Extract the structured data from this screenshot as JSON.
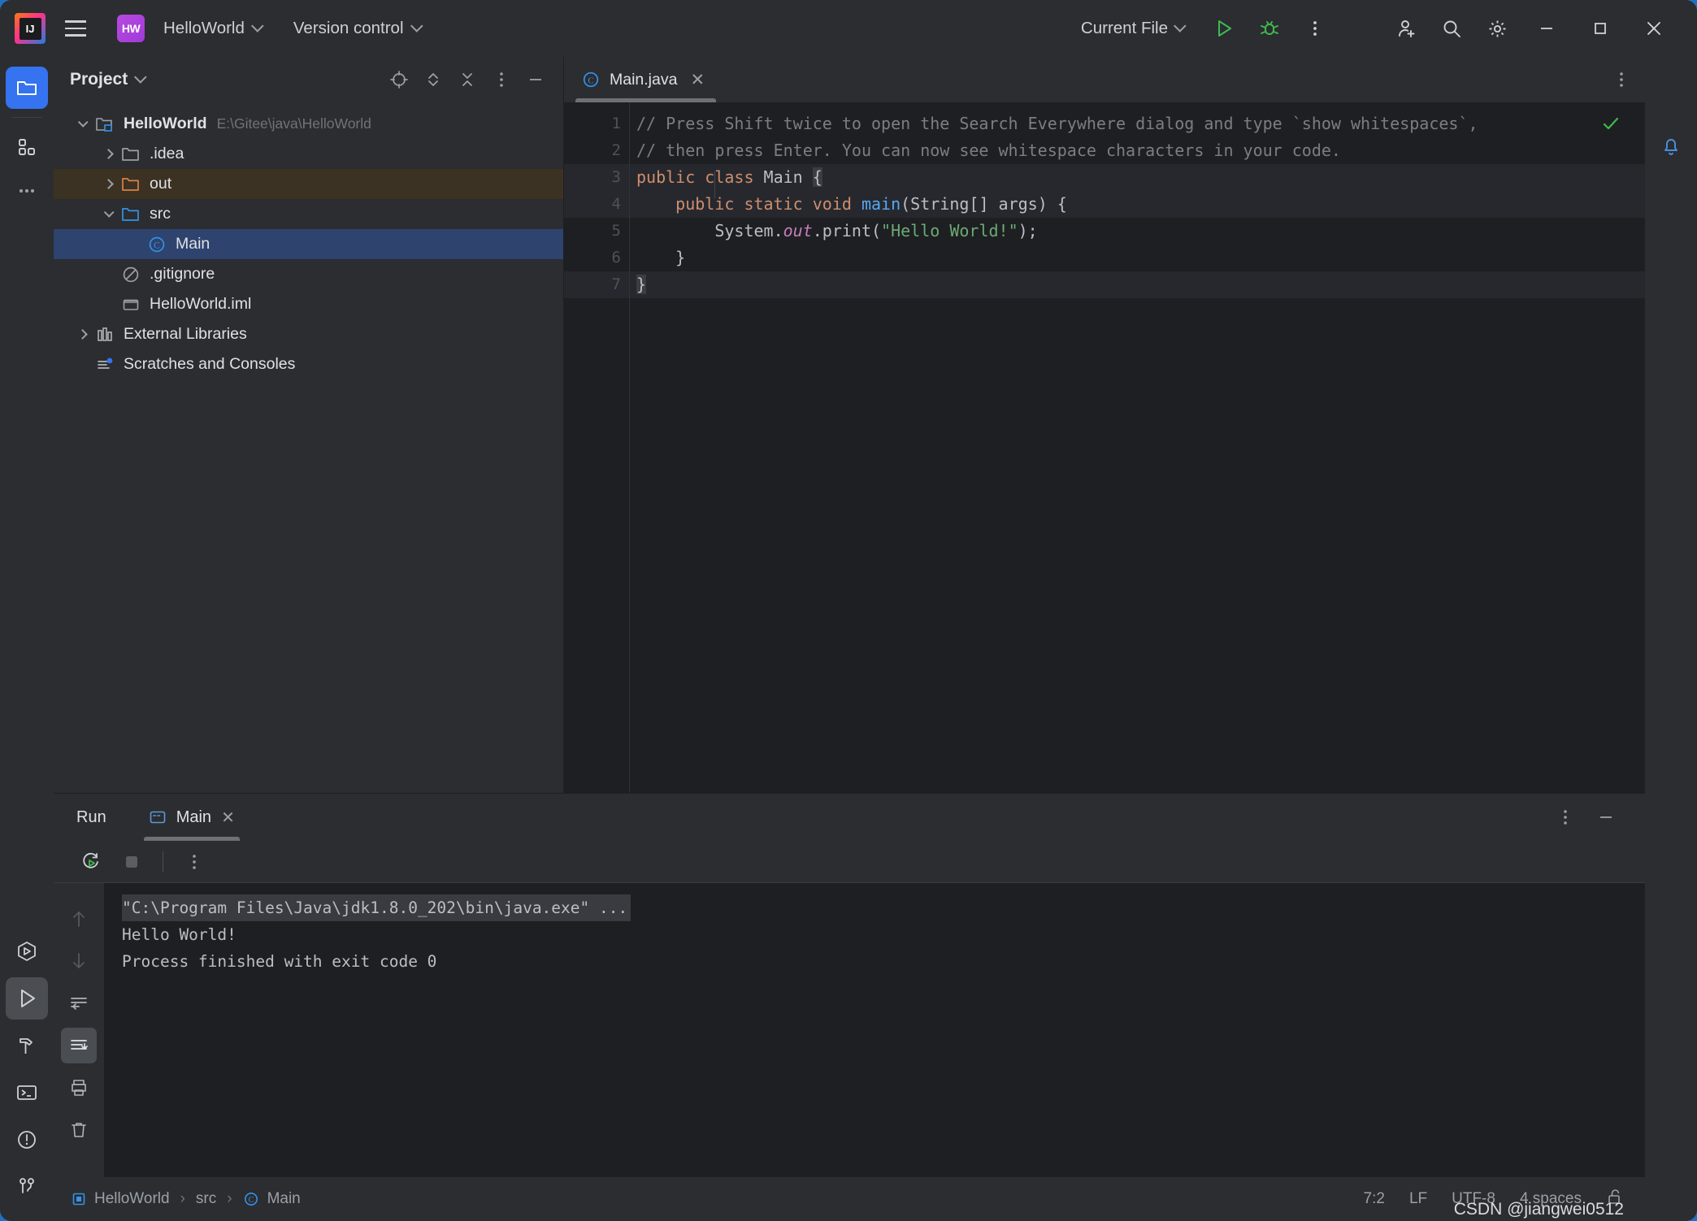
{
  "titlebar": {
    "logo_icon": "intellij-idea-logo",
    "menu_icon": "hamburger-menu-icon",
    "project_badge": "HW",
    "project_name": "HelloWorld",
    "version_control": "Version control",
    "run_config": "Current File",
    "run_icon": "run-icon",
    "debug_icon": "debug-icon",
    "more_icon": "more-vertical-icon",
    "account_icon": "add-user-icon",
    "search_icon": "search-icon",
    "settings_icon": "gear-icon",
    "minimize_icon": "minimize-icon",
    "maximize_icon": "maximize-icon",
    "close_icon": "close-icon"
  },
  "leftstrip": {
    "items": [
      {
        "name": "project-tool-window",
        "icon": "folder-icon",
        "active": true
      },
      {
        "name": "structure-tool-window",
        "icon": "structure-icon",
        "active": false
      },
      {
        "name": "more-tool-windows",
        "icon": "more-horizontal-icon",
        "active": false
      }
    ],
    "bottom_items": [
      {
        "name": "services-tool-window",
        "icon": "services-icon",
        "active": false
      },
      {
        "name": "run-tool-window",
        "icon": "run-triangle-icon",
        "active": true
      },
      {
        "name": "build-tool-window",
        "icon": "hammer-icon",
        "active": false
      },
      {
        "name": "terminal-tool-window",
        "icon": "terminal-icon",
        "active": false
      },
      {
        "name": "problems-tool-window",
        "icon": "warning-circle-icon",
        "active": false
      },
      {
        "name": "version-control-tool-window",
        "icon": "branch-icon",
        "active": false
      }
    ]
  },
  "project_panel": {
    "title": "Project",
    "chevron_icon": "chevron-down-icon",
    "tools": [
      {
        "name": "select-opened-file-button",
        "icon": "crosshair-icon"
      },
      {
        "name": "expand-collapse-button",
        "icon": "expand-collapse-icon"
      },
      {
        "name": "collapse-all-button",
        "icon": "collapse-all-icon"
      },
      {
        "name": "options-button",
        "icon": "more-vertical-icon"
      },
      {
        "name": "hide-button",
        "icon": "minimize-icon"
      }
    ],
    "tree": [
      {
        "label": "HelloWorld",
        "path": "E:\\Gitee\\java\\HelloWorld",
        "icon": "project-folder-icon",
        "depth": 0,
        "arrow": "open",
        "state": "normal",
        "bold": true
      },
      {
        "label": ".idea",
        "path": "",
        "icon": "folder-gray-icon",
        "depth": 1,
        "arrow": "closed",
        "state": "normal",
        "bold": false
      },
      {
        "label": "out",
        "path": "",
        "icon": "folder-orange-icon",
        "depth": 1,
        "arrow": "closed",
        "state": "highlight",
        "bold": false
      },
      {
        "label": "src",
        "path": "",
        "icon": "folder-blue-icon",
        "depth": 1,
        "arrow": "open",
        "state": "normal",
        "bold": false
      },
      {
        "label": "Main",
        "path": "",
        "icon": "java-class-icon",
        "depth": 2,
        "arrow": "none",
        "state": "selected",
        "bold": false
      },
      {
        "label": ".gitignore",
        "path": "",
        "icon": "gitignore-icon",
        "depth": 1,
        "arrow": "none",
        "state": "normal",
        "bold": false
      },
      {
        "label": "HelloWorld.iml",
        "path": "",
        "icon": "iml-file-icon",
        "depth": 1,
        "arrow": "none",
        "state": "normal",
        "bold": false
      },
      {
        "label": "External Libraries",
        "path": "",
        "icon": "library-icon",
        "depth": 0,
        "arrow": "closed",
        "state": "normal",
        "bold": false
      },
      {
        "label": "Scratches and Consoles",
        "path": "",
        "icon": "scratches-icon",
        "depth": 0,
        "arrow": "none",
        "state": "normal",
        "bold": false
      }
    ]
  },
  "editor": {
    "tab": {
      "label": "Main.java",
      "icon": "java-class-icon",
      "close_icon": "close-icon"
    },
    "more_icon": "more-vertical-icon",
    "inspection_icon": "checkmark-ok-icon",
    "line_numbers": [
      "1",
      "2",
      "3",
      "4",
      "5",
      "6",
      "7"
    ],
    "lines": [
      {
        "num": "1",
        "gutter": "",
        "highlight": false,
        "tokens": [
          {
            "cls": "c-comment",
            "t": "// Press Shift twice to open the Search Everywhere dialog and type `show whitespaces`,"
          }
        ]
      },
      {
        "num": "2",
        "gutter": "",
        "highlight": false,
        "tokens": [
          {
            "cls": "c-comment",
            "t": "// then press Enter. You can now see whitespace characters in your code."
          }
        ]
      },
      {
        "num": "3",
        "gutter": "run",
        "highlight": true,
        "tokens": [
          {
            "cls": "c-kw",
            "t": "public "
          },
          {
            "cls": "c-kw",
            "t": "class "
          },
          {
            "cls": "c-plain",
            "t": "Main "
          },
          {
            "cls": "cursorblk c-plain",
            "t": "{"
          }
        ]
      },
      {
        "num": "4",
        "gutter": "run",
        "highlight": true,
        "tokens": [
          {
            "cls": "c-plain",
            "t": "    "
          },
          {
            "cls": "c-kw",
            "t": "public static void "
          },
          {
            "cls": "c-method",
            "t": "main"
          },
          {
            "cls": "c-plain",
            "t": "(String[] args) {"
          }
        ]
      },
      {
        "num": "5",
        "gutter": "",
        "highlight": false,
        "tokens": [
          {
            "cls": "c-plain",
            "t": "        System."
          },
          {
            "cls": "c-field",
            "t": "out"
          },
          {
            "cls": "c-plain",
            "t": ".print("
          },
          {
            "cls": "c-str",
            "t": "\"Hello World!\""
          },
          {
            "cls": "c-plain",
            "t": ");"
          }
        ]
      },
      {
        "num": "6",
        "gutter": "",
        "highlight": false,
        "tokens": [
          {
            "cls": "c-plain",
            "t": "    }"
          }
        ]
      },
      {
        "num": "7",
        "gutter": "",
        "highlight": true,
        "tokens": [
          {
            "cls": "cursorblk c-plain",
            "t": "}"
          }
        ]
      }
    ]
  },
  "run_panel": {
    "title": "Run",
    "tab_label": "Main",
    "tab_icon": "console-icon",
    "tab_close_icon": "close-icon",
    "options_icon": "more-vertical-icon",
    "hide_icon": "minimize-icon",
    "toolbar": [
      {
        "name": "rerun-button",
        "icon": "rerun-icon"
      },
      {
        "name": "stop-button",
        "icon": "stop-icon"
      },
      {
        "name": "more-options-button",
        "icon": "more-vertical-icon"
      }
    ],
    "gutter": [
      {
        "name": "up-button",
        "icon": "arrow-up-icon",
        "selected": false
      },
      {
        "name": "down-button",
        "icon": "arrow-down-icon",
        "selected": false
      },
      {
        "name": "soft-wrap-button",
        "icon": "soft-wrap-icon",
        "selected": false
      },
      {
        "name": "scroll-to-end-button",
        "icon": "scroll-to-end-icon",
        "selected": true
      },
      {
        "name": "print-button",
        "icon": "print-icon",
        "selected": false
      },
      {
        "name": "clear-all-button",
        "icon": "trash-icon",
        "selected": false
      }
    ],
    "console_lines": [
      {
        "text": "\"C:\\Program Files\\Java\\jdk1.8.0_202\\bin\\java.exe\" ...",
        "style": "cmd"
      },
      {
        "text": "Hello World!",
        "style": "normal"
      },
      {
        "text": "Process finished with exit code 0",
        "style": "normal"
      }
    ]
  },
  "statusbar": {
    "breadcrumbs": [
      {
        "label": "HelloWorld",
        "icon": "module-icon"
      },
      {
        "label": "src",
        "icon": ""
      },
      {
        "label": "Main",
        "icon": "java-class-icon"
      }
    ],
    "separator": "›",
    "caret_position": "7:2",
    "line_separator": "LF",
    "encoding": "UTF-8",
    "indent": "4 spaces",
    "lock_icon": "unlocked-icon",
    "watermark": "CSDN @jiangwei0512"
  },
  "notification": {
    "icon": "bell-icon"
  }
}
